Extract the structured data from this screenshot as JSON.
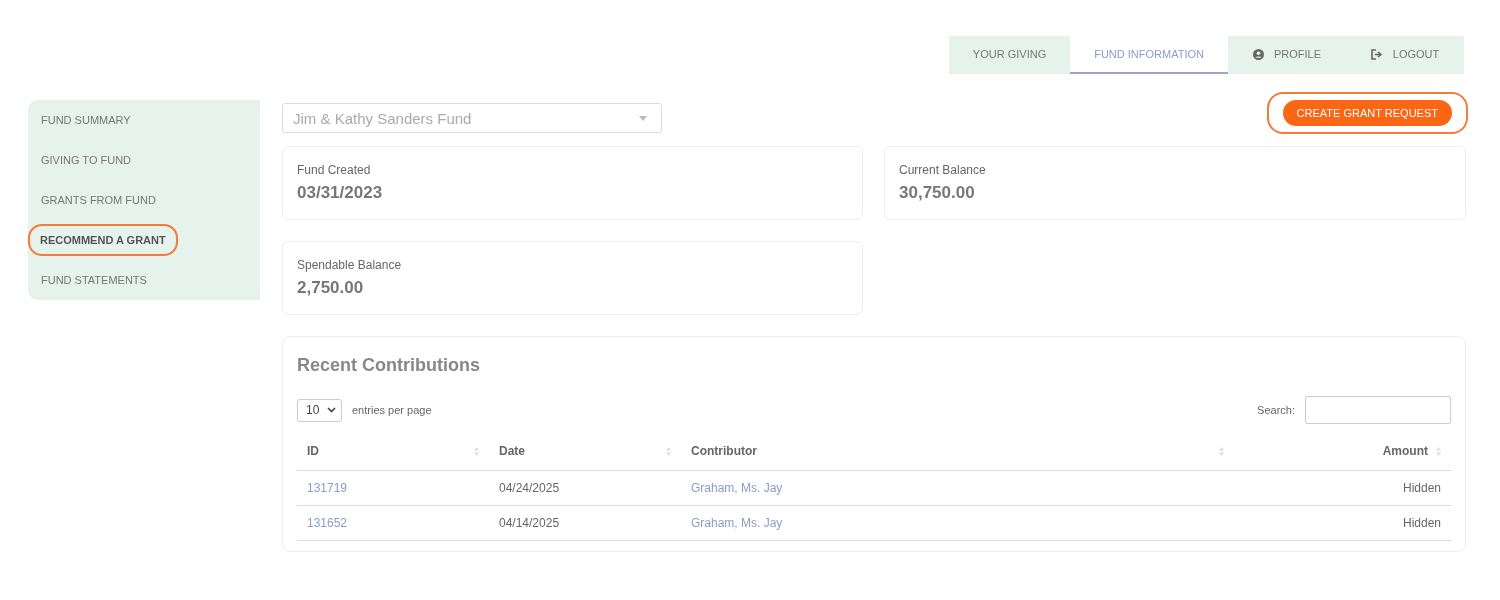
{
  "nav_tabs": [
    {
      "label": "YOUR GIVING",
      "kind": "plain",
      "selected": false
    },
    {
      "label": "FUND INFORMATION",
      "kind": "plain",
      "selected": true
    },
    {
      "label": "PROFILE",
      "kind": "profile",
      "selected": false
    },
    {
      "label": "LOGOUT",
      "kind": "logout",
      "selected": false
    }
  ],
  "sidebar": {
    "items": [
      {
        "label": "FUND SUMMARY",
        "highlighted": false
      },
      {
        "label": "GIVING TO FUND",
        "highlighted": false
      },
      {
        "label": "GRANTS FROM FUND",
        "highlighted": false
      },
      {
        "label": "RECOMMEND A GRANT",
        "highlighted": true
      },
      {
        "label": "FUND STATEMENTS",
        "highlighted": false
      }
    ]
  },
  "fund_select": {
    "value": "Jim & Kathy Sanders Fund"
  },
  "create_button": {
    "label": "CREATE GRANT REQUEST",
    "highlighted": true
  },
  "stats": [
    {
      "label": "Fund Created",
      "value": "03/31/2023"
    },
    {
      "label": "Current Balance",
      "value": "30,750.00"
    },
    {
      "label": "Spendable Balance",
      "value": "2,750.00"
    }
  ],
  "contributions": {
    "title": "Recent Contributions",
    "page_size": "10",
    "page_size_label": "entries per page",
    "search_label": "Search:",
    "columns": [
      {
        "label": "ID"
      },
      {
        "label": "Date"
      },
      {
        "label": "Contributor"
      },
      {
        "label": "Amount"
      }
    ],
    "rows": [
      {
        "id": "131719",
        "date": "04/24/2025",
        "contributor": "Graham, Ms. Jay",
        "amount": "Hidden"
      },
      {
        "id": "131652",
        "date": "04/14/2025",
        "contributor": "Graham, Ms. Jay",
        "amount": "Hidden"
      }
    ]
  }
}
